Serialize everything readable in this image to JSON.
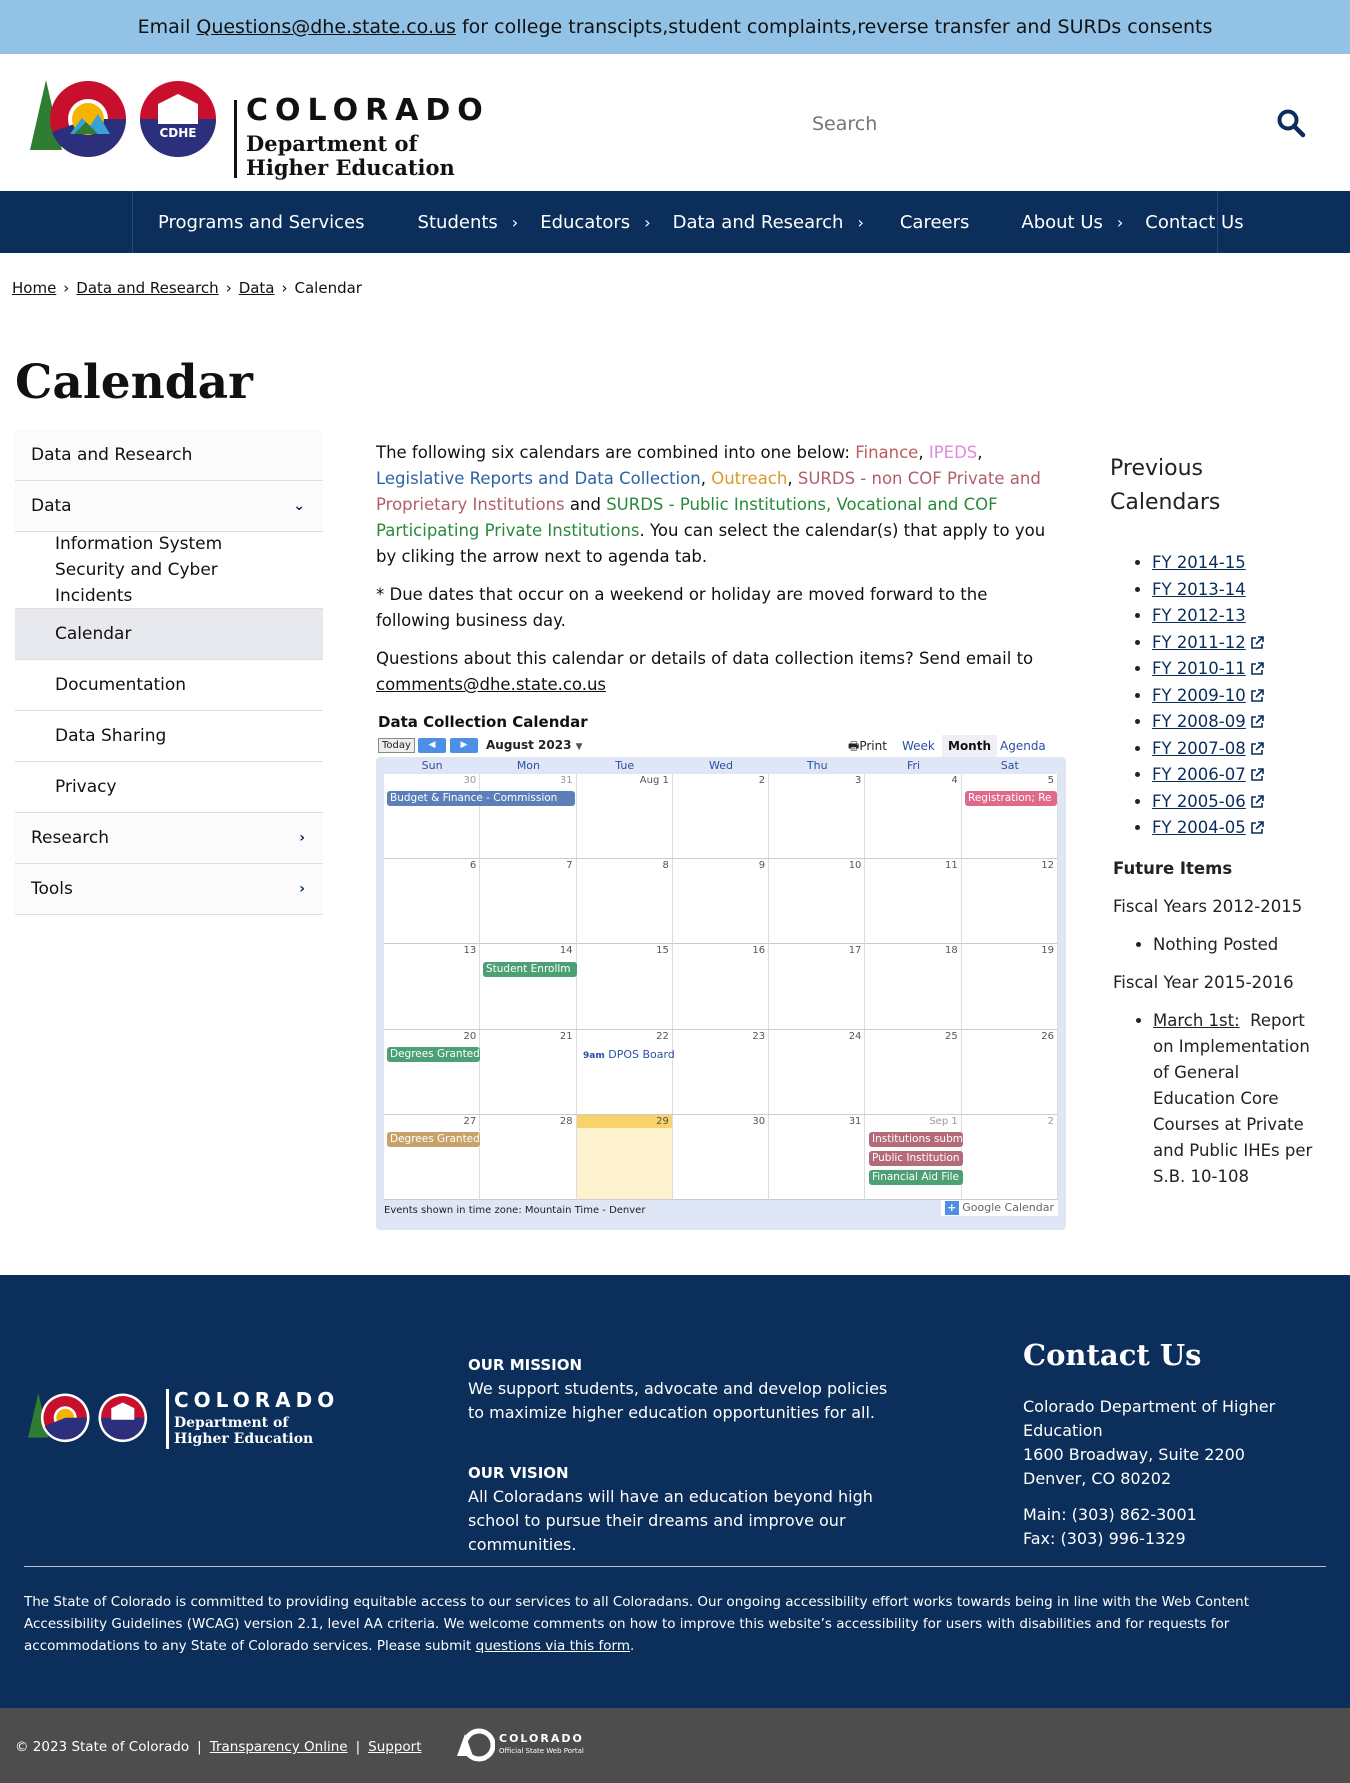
{
  "banner": {
    "prefix": "Email",
    "email": "Questions@dhe.state.co.us",
    "suffix": "for college transcipts,student complaints,reverse transfer and SURDs consents"
  },
  "header": {
    "logo_title": "COLORADO",
    "logo_dept_line1": "Department of",
    "logo_dept_line2": "Higher Education",
    "logo_badge": "CDHE",
    "search_placeholder": "Search"
  },
  "nav": [
    {
      "label": "Programs and Services",
      "has_children": false
    },
    {
      "label": "Students",
      "has_children": true
    },
    {
      "label": "Educators",
      "has_children": true
    },
    {
      "label": "Data and Research",
      "has_children": true
    },
    {
      "label": "Careers",
      "has_children": false
    },
    {
      "label": "About Us",
      "has_children": true
    },
    {
      "label": "Contact Us",
      "has_children": false
    }
  ],
  "breadcrumb": [
    "Home",
    "Data and Research",
    "Data",
    "Calendar"
  ],
  "page_title": "Calendar",
  "sidebar": [
    {
      "label": "Data and Research"
    },
    {
      "label": "Data",
      "icon": "chevron-down"
    },
    {
      "label": "Information System Security and Cyber Incidents"
    },
    {
      "label": "Calendar"
    },
    {
      "label": "Documentation"
    },
    {
      "label": "Data Sharing"
    },
    {
      "label": "Privacy"
    },
    {
      "label": "Research",
      "icon": "chevron-right"
    },
    {
      "label": "Tools",
      "icon": "chevron-right"
    }
  ],
  "intro": {
    "lead": "The following six calendars are combined into one below:",
    "finance": "Finance",
    "ipeds": "IPEDS",
    "legislative": "Legislative Reports and Data Collection",
    "outreach": "Outreach",
    "surds_private": "SURDS - non COF Private and Proprietary Institutions",
    "and": "and",
    "surds_public": "SURDS - Public Institutions, Vocational and COF Participating Private Institutions",
    "tail": ". You can select the calendar(s) that apply to you by cliking the arrow next to agenda tab.",
    "note": "* Due dates that occur on a weekend or holiday are moved forward to the following business day.",
    "questions": "Questions about this calendar or details of data collection items?  Send email to",
    "email": "comments@dhe.state.co.us"
  },
  "calendar": {
    "title": "Data Collection Calendar",
    "today_label": "Today",
    "month_label": "August 2023",
    "print_label": "Print",
    "tabs": [
      "Week",
      "Month",
      "Agenda"
    ],
    "active_tab": "Month",
    "days_of_week": [
      "Sun",
      "Mon",
      "Tue",
      "Wed",
      "Thu",
      "Fri",
      "Sat"
    ],
    "weeks": [
      [
        "30",
        "31",
        "Aug 1",
        "2",
        "3",
        "4",
        "5"
      ],
      [
        "6",
        "7",
        "8",
        "9",
        "10",
        "11",
        "12"
      ],
      [
        "13",
        "14",
        "15",
        "16",
        "17",
        "18",
        "19"
      ],
      [
        "20",
        "21",
        "22",
        "23",
        "24",
        "25",
        "26"
      ],
      [
        "27",
        "28",
        "29",
        "30",
        "31",
        "Sep 1",
        "2"
      ]
    ],
    "today_index": [
      4,
      2
    ],
    "events": {
      "budget": "Budget & Finance - Commission",
      "registration": "Registration; Re",
      "student_enroll": "Student Enrollm",
      "degrees1": "Degrees Granted",
      "dpos_time": "9am",
      "dpos": "DPOS Board",
      "degrees2": "Degrees Granted",
      "institutions": "Institutions subm",
      "public": "Public Institution",
      "finaid": "Financial Aid File"
    },
    "event_colors": {
      "finance": "#5c7fb8",
      "legislative": "#4da074",
      "surds_public": "#4da074",
      "outreach": "#c9a26a",
      "surds_private": "#b56a7a",
      "registration": "#e0688a"
    },
    "timezone_note": "Events shown in time zone: Mountain Time - Denver",
    "gcal_label": "Google Calendar"
  },
  "previous": {
    "title": "Previous Calendars",
    "years": [
      {
        "label": "FY 2014-15",
        "external": false
      },
      {
        "label": "FY 2013-14",
        "external": false
      },
      {
        "label": "FY 2012-13",
        "external": false
      },
      {
        "label": "FY 2011-12",
        "external": true
      },
      {
        "label": "FY 2010-11",
        "external": true
      },
      {
        "label": "FY 2009-10",
        "external": true
      },
      {
        "label": "FY 2008-09",
        "external": true
      },
      {
        "label": "FY 2007-08",
        "external": true
      },
      {
        "label": "FY 2006-07",
        "external": true
      },
      {
        "label": "FY 2005-06",
        "external": true
      },
      {
        "label": "FY 2004-05",
        "external": true
      }
    ]
  },
  "future": {
    "heading": "Future Items",
    "fy_a": "Fiscal Years 2012-2015",
    "fy_a_item": "Nothing Posted",
    "fy_b": "Fiscal Year 2015-2016",
    "fy_b_date": "March 1st:",
    "fy_b_item": "Report on Implementation of General Education Core Courses at Private and Public IHEs per S.B. 10-108"
  },
  "footer": {
    "mission_heading": "OUR MISSION",
    "mission_text": "We support students, advocate and develop policies to maximize higher education opportunities for all.",
    "vision_heading": "OUR VISION",
    "vision_text": "All Coloradans will have an education beyond high school to pursue their dreams and improve our communities.",
    "contact_heading": "Contact Us",
    "address1": "Colorado Department of Higher Education",
    "address2": "1600 Broadway, Suite 2200",
    "address3": "Denver, CO 80202",
    "main_phone": "Main: (303) 862-3001",
    "fax": "Fax: (303) 996-1329",
    "accessibility": "The State of Colorado is committed to providing equitable access to our services to all Coloradans. Our ongoing accessibility effort works towards being in line with the Web Content Accessibility Guidelines (WCAG) version 2.1, level AA criteria. We welcome comments on how to improve this website’s accessibility for users with disabilities and for requests for accommodations to any State of Colorado services. Please submit",
    "accessibility_link": "questions via this form",
    "copyright": "© 2023 State of Colorado",
    "transparency": "Transparency Online",
    "support": "Support",
    "portal_title": "COLORADO",
    "portal_sub": "Official State Web Portal"
  },
  "colors": {
    "banner": "#92c3e6",
    "navy": "#0b2e5a",
    "bottom_bar": "#4d4d4d"
  }
}
